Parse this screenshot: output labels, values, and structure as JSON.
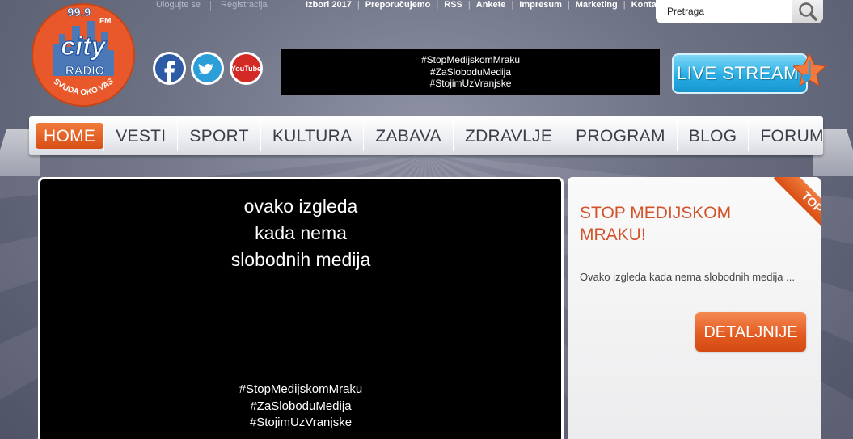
{
  "logo": {
    "frequency": "99.9",
    "band": "FM",
    "brand_top": "city",
    "brand_bottom": "RADIO",
    "slogan": "SVUDA OKO VAS"
  },
  "auth": {
    "login": "Ulogujte se",
    "register": "Registracija"
  },
  "top_links": [
    "Izbori 2017",
    "Preporučujemo",
    "RSS",
    "Ankete",
    "Impresum",
    "Marketing",
    "Kontakt"
  ],
  "search": {
    "placeholder": "Pretraga",
    "icon": "search-icon"
  },
  "social": {
    "facebook": "facebook-icon",
    "twitter": "twitter-icon",
    "youtube_label": "YouTube"
  },
  "banner": {
    "lines": [
      "#StopMedijskomMraku",
      "#ZaSloboduMedija",
      "#StojimUzVranjske"
    ]
  },
  "live_stream": {
    "label": "LIVE STREAM"
  },
  "nav": {
    "items": [
      "HOME",
      "VESTI",
      "SPORT",
      "KULTURA",
      "ZABAVA",
      "ZDRAVLJE",
      "PROGRAM",
      "BLOG",
      "FORUM"
    ],
    "active": "HOME"
  },
  "video": {
    "lines": [
      "ovako izgleda",
      "kada nema",
      "slobodnih medija"
    ],
    "tags": [
      "#StopMedijskomMraku",
      "#ZaSloboduMedija",
      "#StojimUzVranjske"
    ]
  },
  "panel": {
    "title": "STOP MEDIJSKOM MRAKU!",
    "excerpt": "Ovako izgleda kada nema slobodnih medija ...",
    "button": "DETALJNIJE",
    "ribbon": "TOP"
  },
  "colors": {
    "accent": "#e0561c",
    "nav_text": "#3b3d48",
    "title": "#d4522a"
  }
}
